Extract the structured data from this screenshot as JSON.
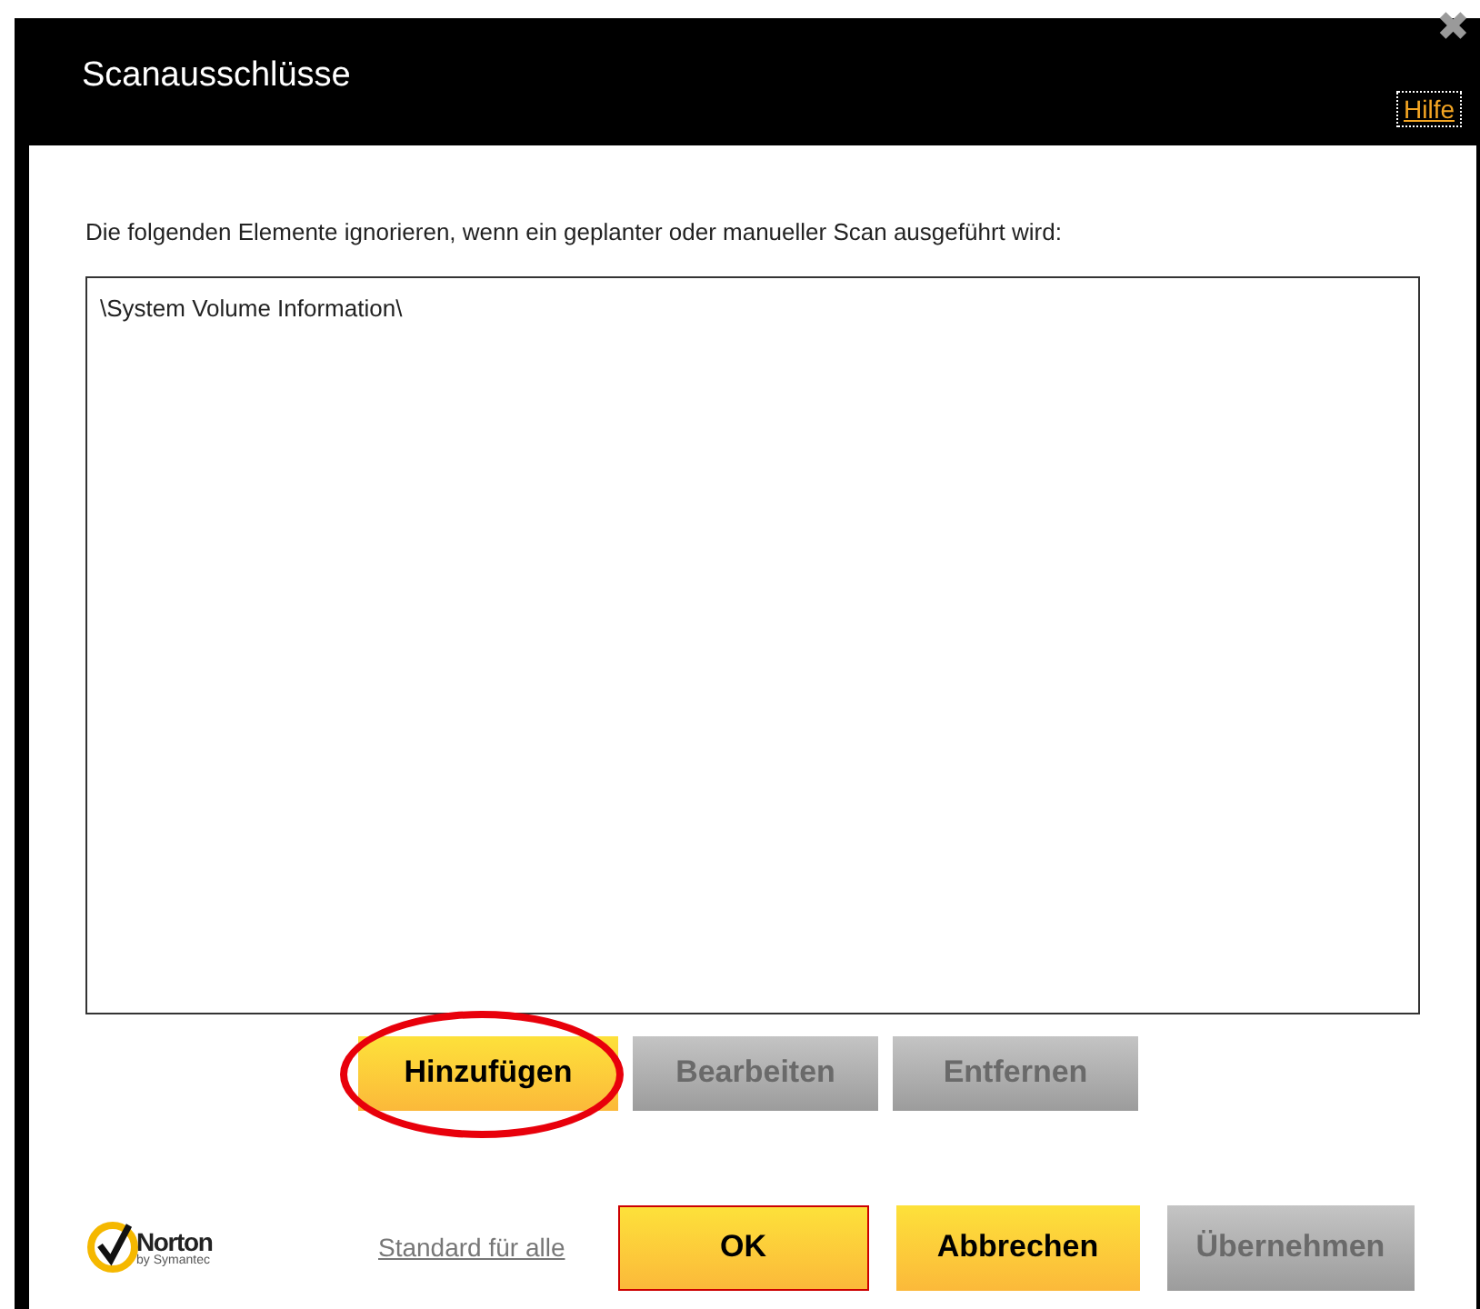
{
  "window": {
    "title": "Scanausschlüsse",
    "help_link": "Hilfe",
    "close": "✖"
  },
  "description": "Die folgenden Elemente ignorieren, wenn ein geplanter oder manueller Scan ausgeführt wird:",
  "exclusions": [
    {
      "text": "\\System Volume Information\\",
      "selected": false
    }
  ],
  "list_buttons": [
    {
      "label": "Hinzufügen",
      "disabled": false,
      "highlighted": true
    },
    {
      "label": "Bearbeiten",
      "disabled": true,
      "highlighted": false
    },
    {
      "label": "Entfernen",
      "disabled": true,
      "highlighted": false
    }
  ],
  "logo": {
    "name": "Norton",
    "byline": "by Symantec"
  },
  "defaults_link": "Standard für alle",
  "dialog_buttons": [
    {
      "label": "OK",
      "disabled": false,
      "default": true
    },
    {
      "label": "Abbrechen",
      "disabled": false,
      "default": false
    },
    {
      "label": "Übernehmen",
      "disabled": true,
      "default": false
    }
  ]
}
